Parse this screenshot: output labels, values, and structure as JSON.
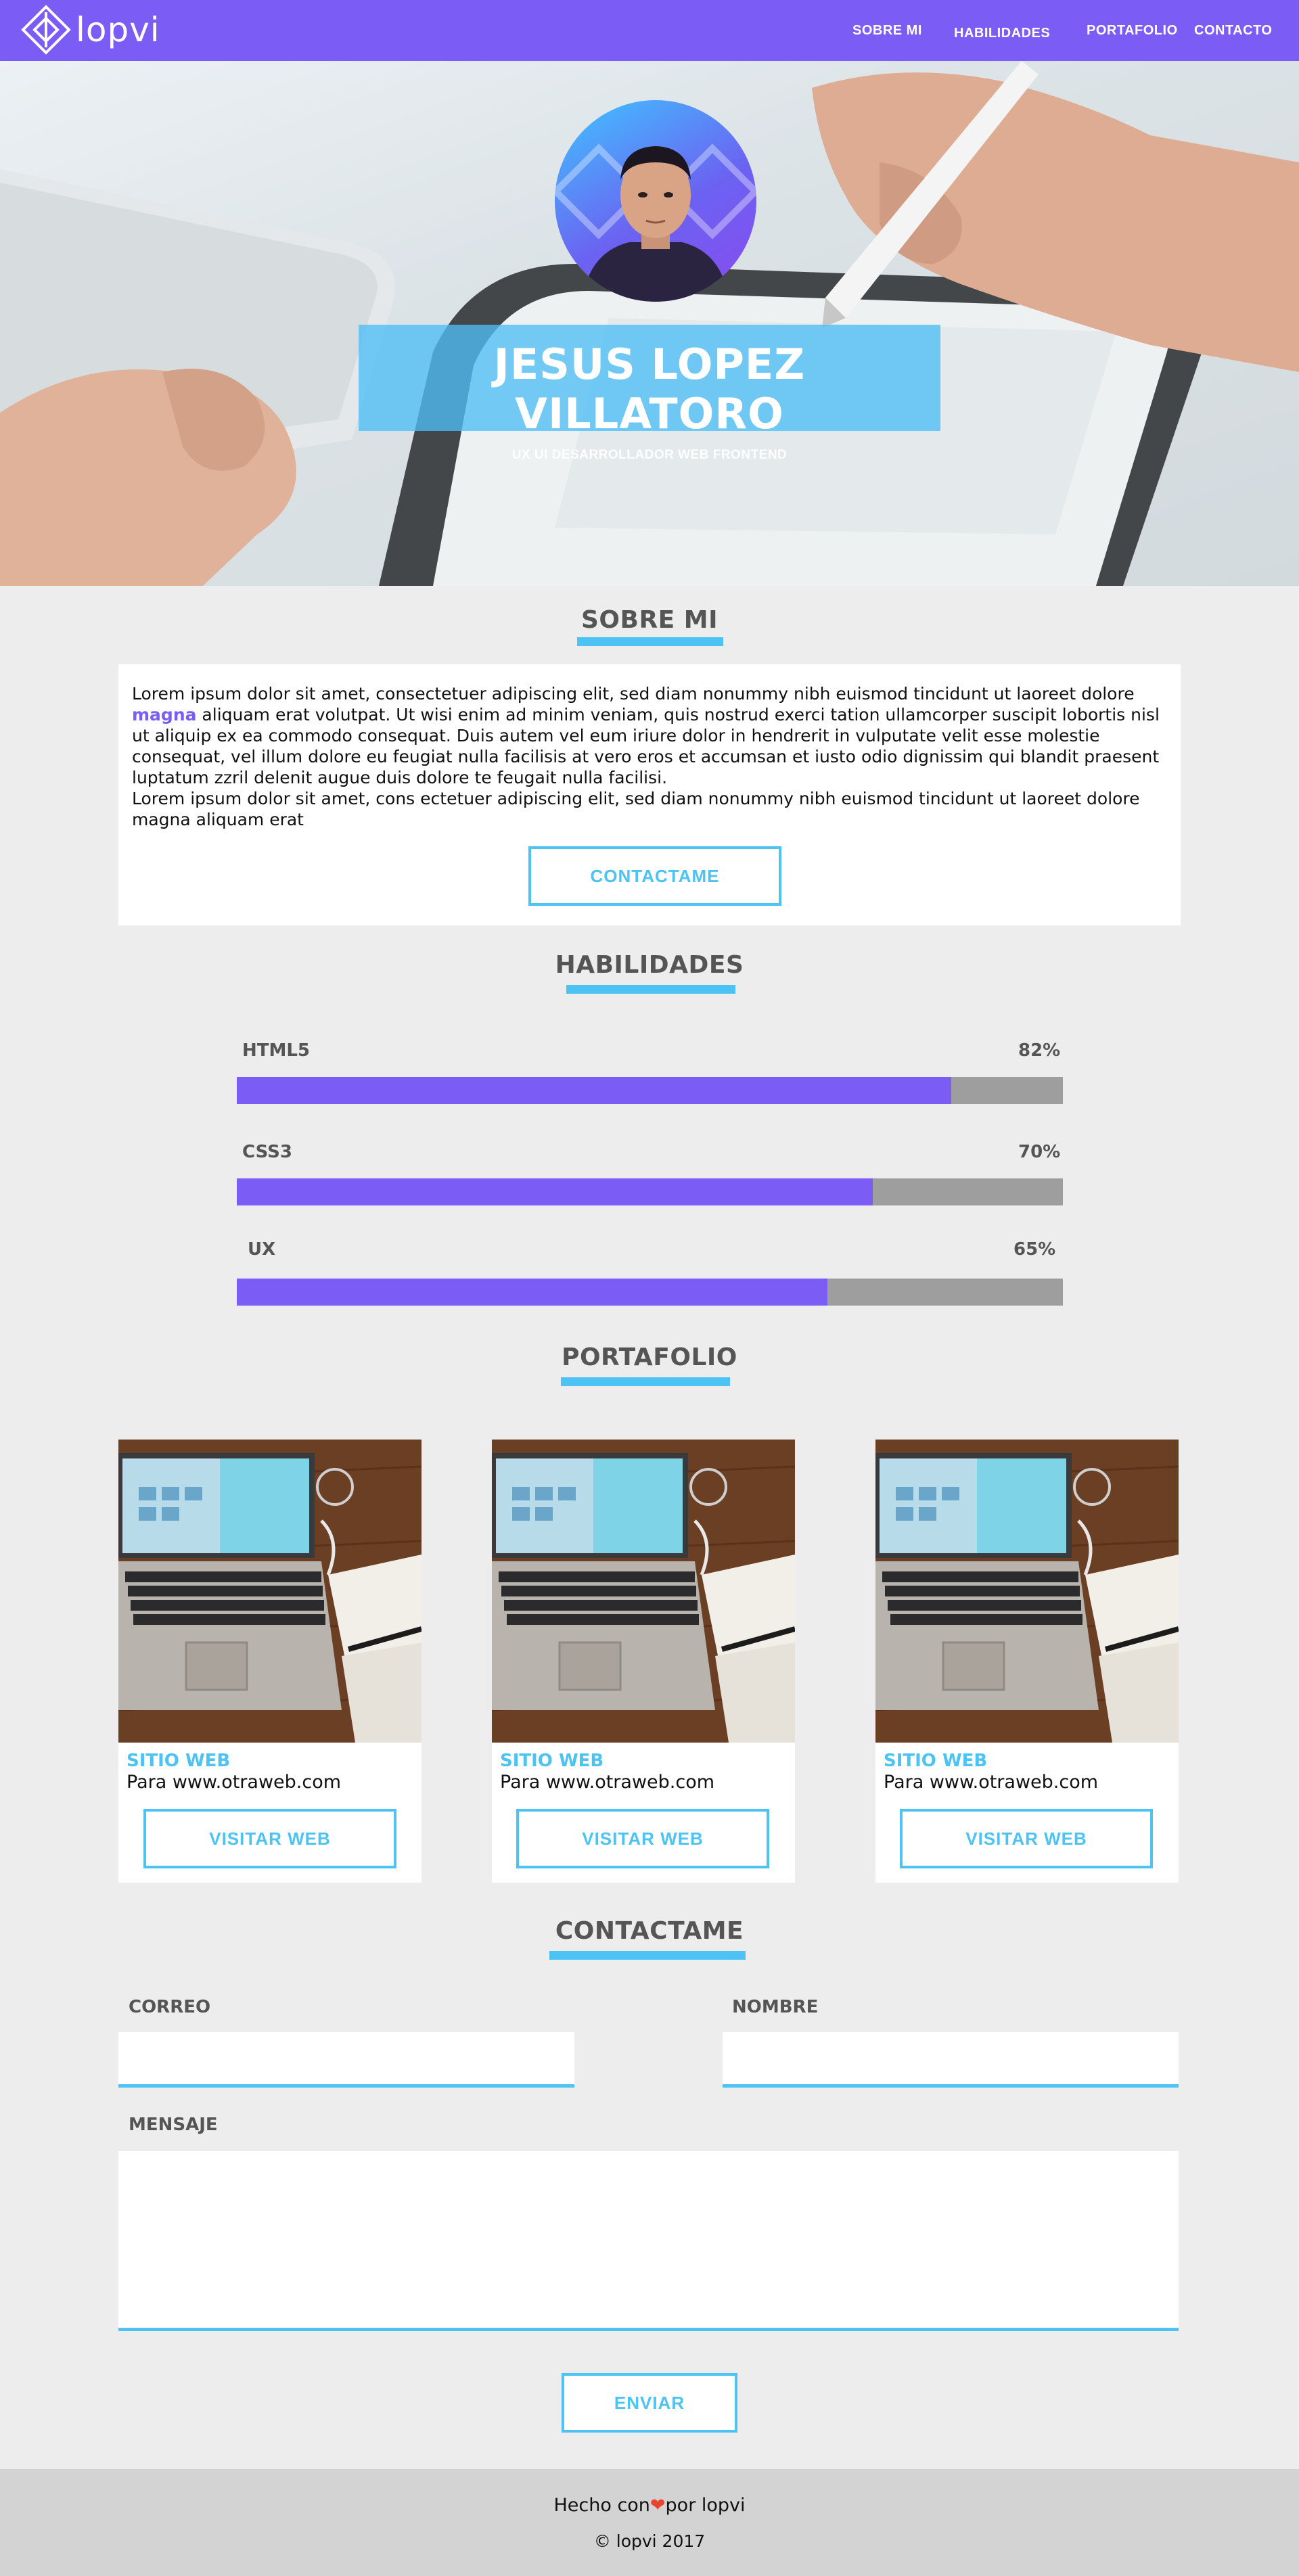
{
  "nav": {
    "logo_text": "lopvi",
    "links": [
      "SOBRE MI",
      "HABILIDADES",
      "PORTAFOLIO",
      "CONTACTO"
    ]
  },
  "hero": {
    "name": "JESUS LOPEZ VILLATORO",
    "subtitle": "UX UI DESARROLLADOR WEB FRONTEND"
  },
  "about": {
    "title": "SOBRE MI",
    "text_before": "Lorem ipsum dolor sit amet, consectetuer adipiscing elit, sed diam nonummy nibh euismod tincidunt ut laoreet dolore ",
    "highlight": "magna",
    "text_after": " aliquam erat volutpat. Ut wisi enim ad minim veniam, quis nostrud exerci tation ullamcorper suscipit lobortis nisl ut aliquip ex ea commodo consequat. Duis autem vel eum iriure dolor in hendrerit in vulputate velit esse molestie consequat, vel illum dolore eu feugiat nulla facilisis at vero eros et accumsan et iusto odio dignissim qui blandit praesent luptatum zzril delenit augue duis dolore te feugait nulla facilisi.",
    "text_second": "Lorem ipsum dolor sit amet, cons ectetuer adipiscing elit, sed diam nonummy nibh euismod tincidunt ut laoreet dolore magna aliquam erat",
    "button": "CONTACTAME"
  },
  "skills": {
    "title": "HABILIDADES",
    "items": [
      {
        "name": "HTML5",
        "percent_label": "82%",
        "fill": 0.865
      },
      {
        "name": "CSS3",
        "percent_label": "70%",
        "fill": 0.77
      },
      {
        "name": "UX",
        "percent_label": "65%",
        "fill": 0.715
      }
    ],
    "colors": {
      "fill": "#7b5cf5",
      "track": "#9e9e9e"
    }
  },
  "portfolio": {
    "title": "PORTAFOLIO",
    "cards": [
      {
        "type": "SITIO WEB",
        "desc": "Para www.otraweb.com",
        "button": "VISITAR WEB"
      },
      {
        "type": "SITIO WEB",
        "desc": "Para www.otraweb.com",
        "button": "VISITAR WEB"
      },
      {
        "type": "SITIO WEB",
        "desc": "Para www.otraweb.com",
        "button": "VISITAR WEB"
      }
    ]
  },
  "contact": {
    "title": "CONTACTAME",
    "email_label": "CORREO",
    "name_label": "NOMBRE",
    "message_label": "MENSAJE",
    "submit": "ENVIAR"
  },
  "footer": {
    "made_prefix": "Hecho con",
    "heart": "❤",
    "made_suffix": "por lopvi",
    "copyright": "© lopvi 2017"
  },
  "theme": {
    "primary": "#7b5cf5",
    "accent": "#4cc3f3",
    "background": "#ededed",
    "footer": "#d3d3d3"
  }
}
